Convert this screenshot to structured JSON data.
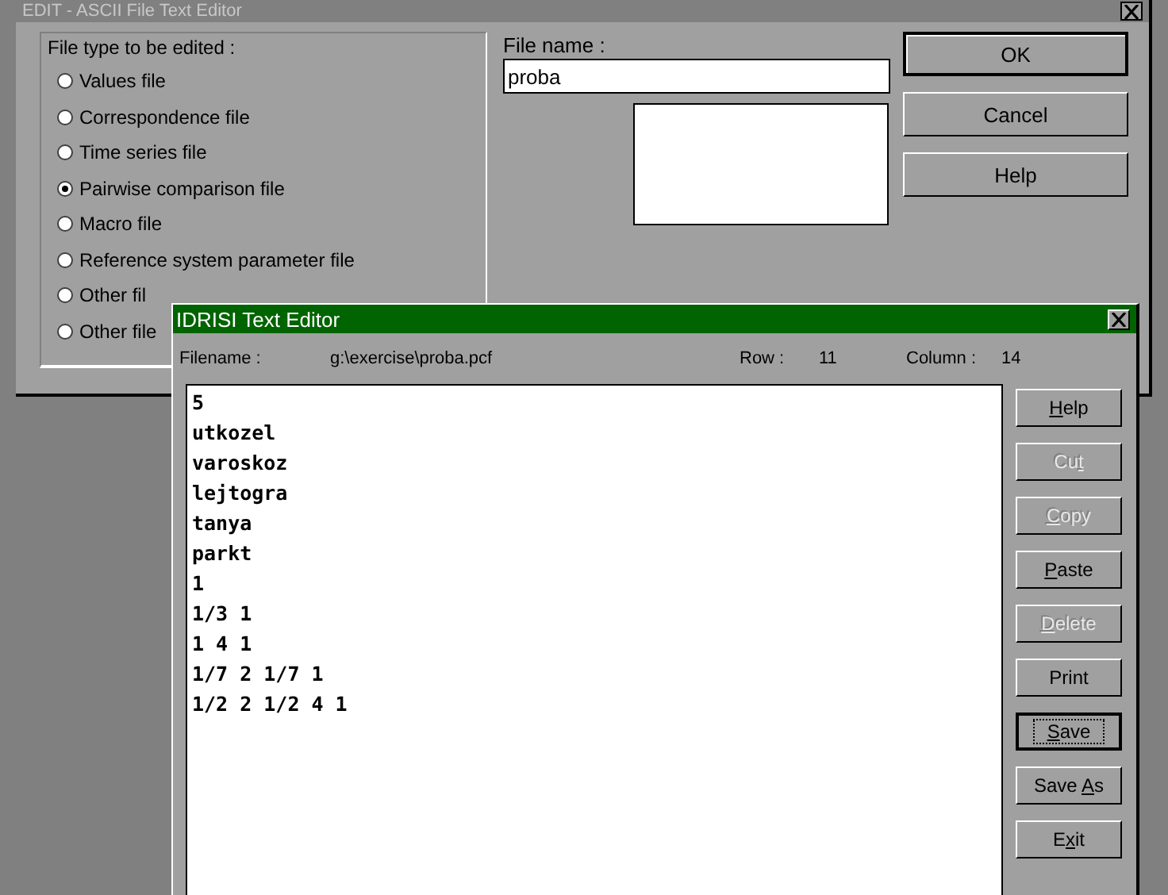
{
  "dialog": {
    "title": "EDIT - ASCII File Text Editor",
    "file_type": {
      "legend": "File type to be edited :",
      "options": [
        {
          "label": "Values file",
          "selected": false
        },
        {
          "label": "Correspondence file",
          "selected": false
        },
        {
          "label": "Time series file",
          "selected": false
        },
        {
          "label": "Pairwise comparison file",
          "selected": true
        },
        {
          "label": "Macro file",
          "selected": false
        },
        {
          "label": "Reference system parameter file",
          "selected": false
        },
        {
          "label": "Other fil",
          "selected": false
        },
        {
          "label": "Other file",
          "selected": false
        }
      ]
    },
    "file_name": {
      "label": "File name :",
      "value": "proba"
    },
    "buttons": [
      {
        "label": "OK",
        "default": true
      },
      {
        "label": "Cancel",
        "default": false
      },
      {
        "label": "Help",
        "default": false
      }
    ]
  },
  "editor": {
    "title": "IDRISI Text Editor",
    "filename_label": "Filename :",
    "filename": "g:\\exercise\\proba.pcf",
    "row_label": "Row :",
    "row": "11",
    "column_label": "Column :",
    "column": "14",
    "lines": [
      "5",
      "utkozel",
      "varoskoz",
      "lejtogra",
      "tanya",
      "parkt",
      "1",
      "1/3 1",
      "1 4 1",
      "1/7 2 1/7 1",
      "1/2 2 1/2 4 1"
    ],
    "buttons": [
      {
        "key": "H",
        "after": "elp",
        "disabled": false,
        "focused": false
      },
      {
        "before": "Cu",
        "key": "t",
        "disabled": true,
        "focused": false
      },
      {
        "key": "C",
        "after": "opy",
        "disabled": true,
        "focused": false
      },
      {
        "key": "P",
        "after": "aste",
        "disabled": false,
        "focused": false
      },
      {
        "key": "D",
        "after": "elete",
        "disabled": true,
        "focused": false
      },
      {
        "before": "Print",
        "disabled": false,
        "focused": false
      },
      {
        "key": "S",
        "after": "ave",
        "disabled": false,
        "focused": true
      },
      {
        "before": "Save ",
        "key": "A",
        "after": "s",
        "disabled": false,
        "focused": false
      },
      {
        "before": "E",
        "key": "x",
        "after": "it",
        "disabled": false,
        "focused": false
      }
    ]
  }
}
